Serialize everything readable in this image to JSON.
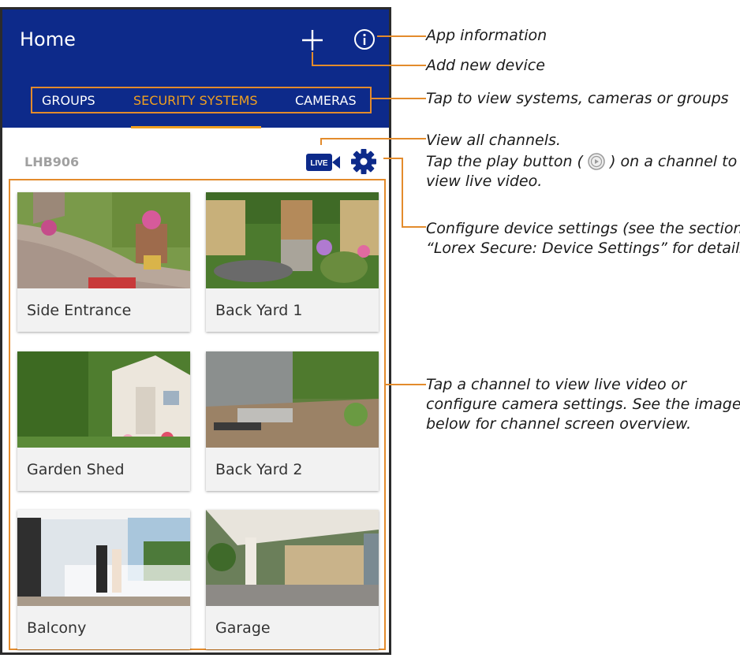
{
  "header": {
    "title": "Home",
    "add_icon": "plus-icon",
    "info_icon": "info-circle-icon"
  },
  "tabs": [
    {
      "label": "GROUPS",
      "active": false
    },
    {
      "label": "SECURITY SYSTEMS",
      "active": true
    },
    {
      "label": "CAMERAS",
      "active": false
    }
  ],
  "device": {
    "name": "LHB906",
    "live_label": "LIVE",
    "settings_icon": "gear-icon"
  },
  "channels": [
    {
      "label": "Side Entrance"
    },
    {
      "label": "Back Yard 1"
    },
    {
      "label": "Garden Shed"
    },
    {
      "label": "Back Yard 2"
    },
    {
      "label": "Balcony"
    },
    {
      "label": "Garage"
    }
  ],
  "annotations": {
    "app_info": "App information",
    "add_device": "Add new device",
    "tabs": "Tap to view systems, cameras or groups",
    "view_channels_1": "View all channels.",
    "view_channels_2a": "Tap the play button (",
    "view_channels_2b": ") on a channel to",
    "view_channels_3": "view live video.",
    "configure_1": "Configure device settings (see the section",
    "configure_2": "“Lorex Secure: Device Settings” for details)",
    "channel_1": "Tap a channel to view live video or",
    "channel_2": "configure camera settings. See the image",
    "channel_3": "below for channel screen overview."
  },
  "colors": {
    "header_bg": "#0d2a8a",
    "accent": "#f0a020",
    "callout": "#e38b2c"
  }
}
